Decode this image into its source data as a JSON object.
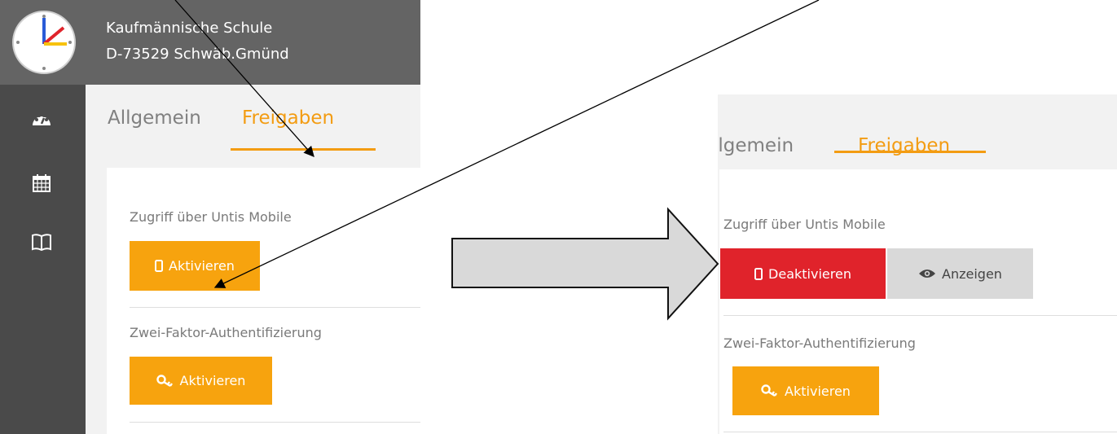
{
  "school": {
    "name": "Kaufmännische Schule",
    "address": "D-73529 Schwäb.Gmünd"
  },
  "tabs": {
    "general": "Allgemein",
    "general_cropped": "llgemein",
    "shares": "Freigaben"
  },
  "sections": {
    "mobile_label": "Zugriff über Untis Mobile",
    "twofa_label": "Zwei-Faktor-Authentifizierung"
  },
  "buttons": {
    "activate": "Aktivieren",
    "deactivate": "Deaktivieren",
    "show": "Anzeigen"
  },
  "colors": {
    "accent": "#f39c12",
    "button_orange": "#f7a30e",
    "button_red": "#e0232b",
    "topbar": "#646464",
    "sidebar": "#4a4a4a"
  },
  "icons": {
    "sidebar": [
      "dashboard-icon",
      "calendar-icon",
      "book-icon"
    ],
    "mobile": "mobile-phone-icon",
    "key": "key-icon",
    "eye": "eye-icon"
  }
}
